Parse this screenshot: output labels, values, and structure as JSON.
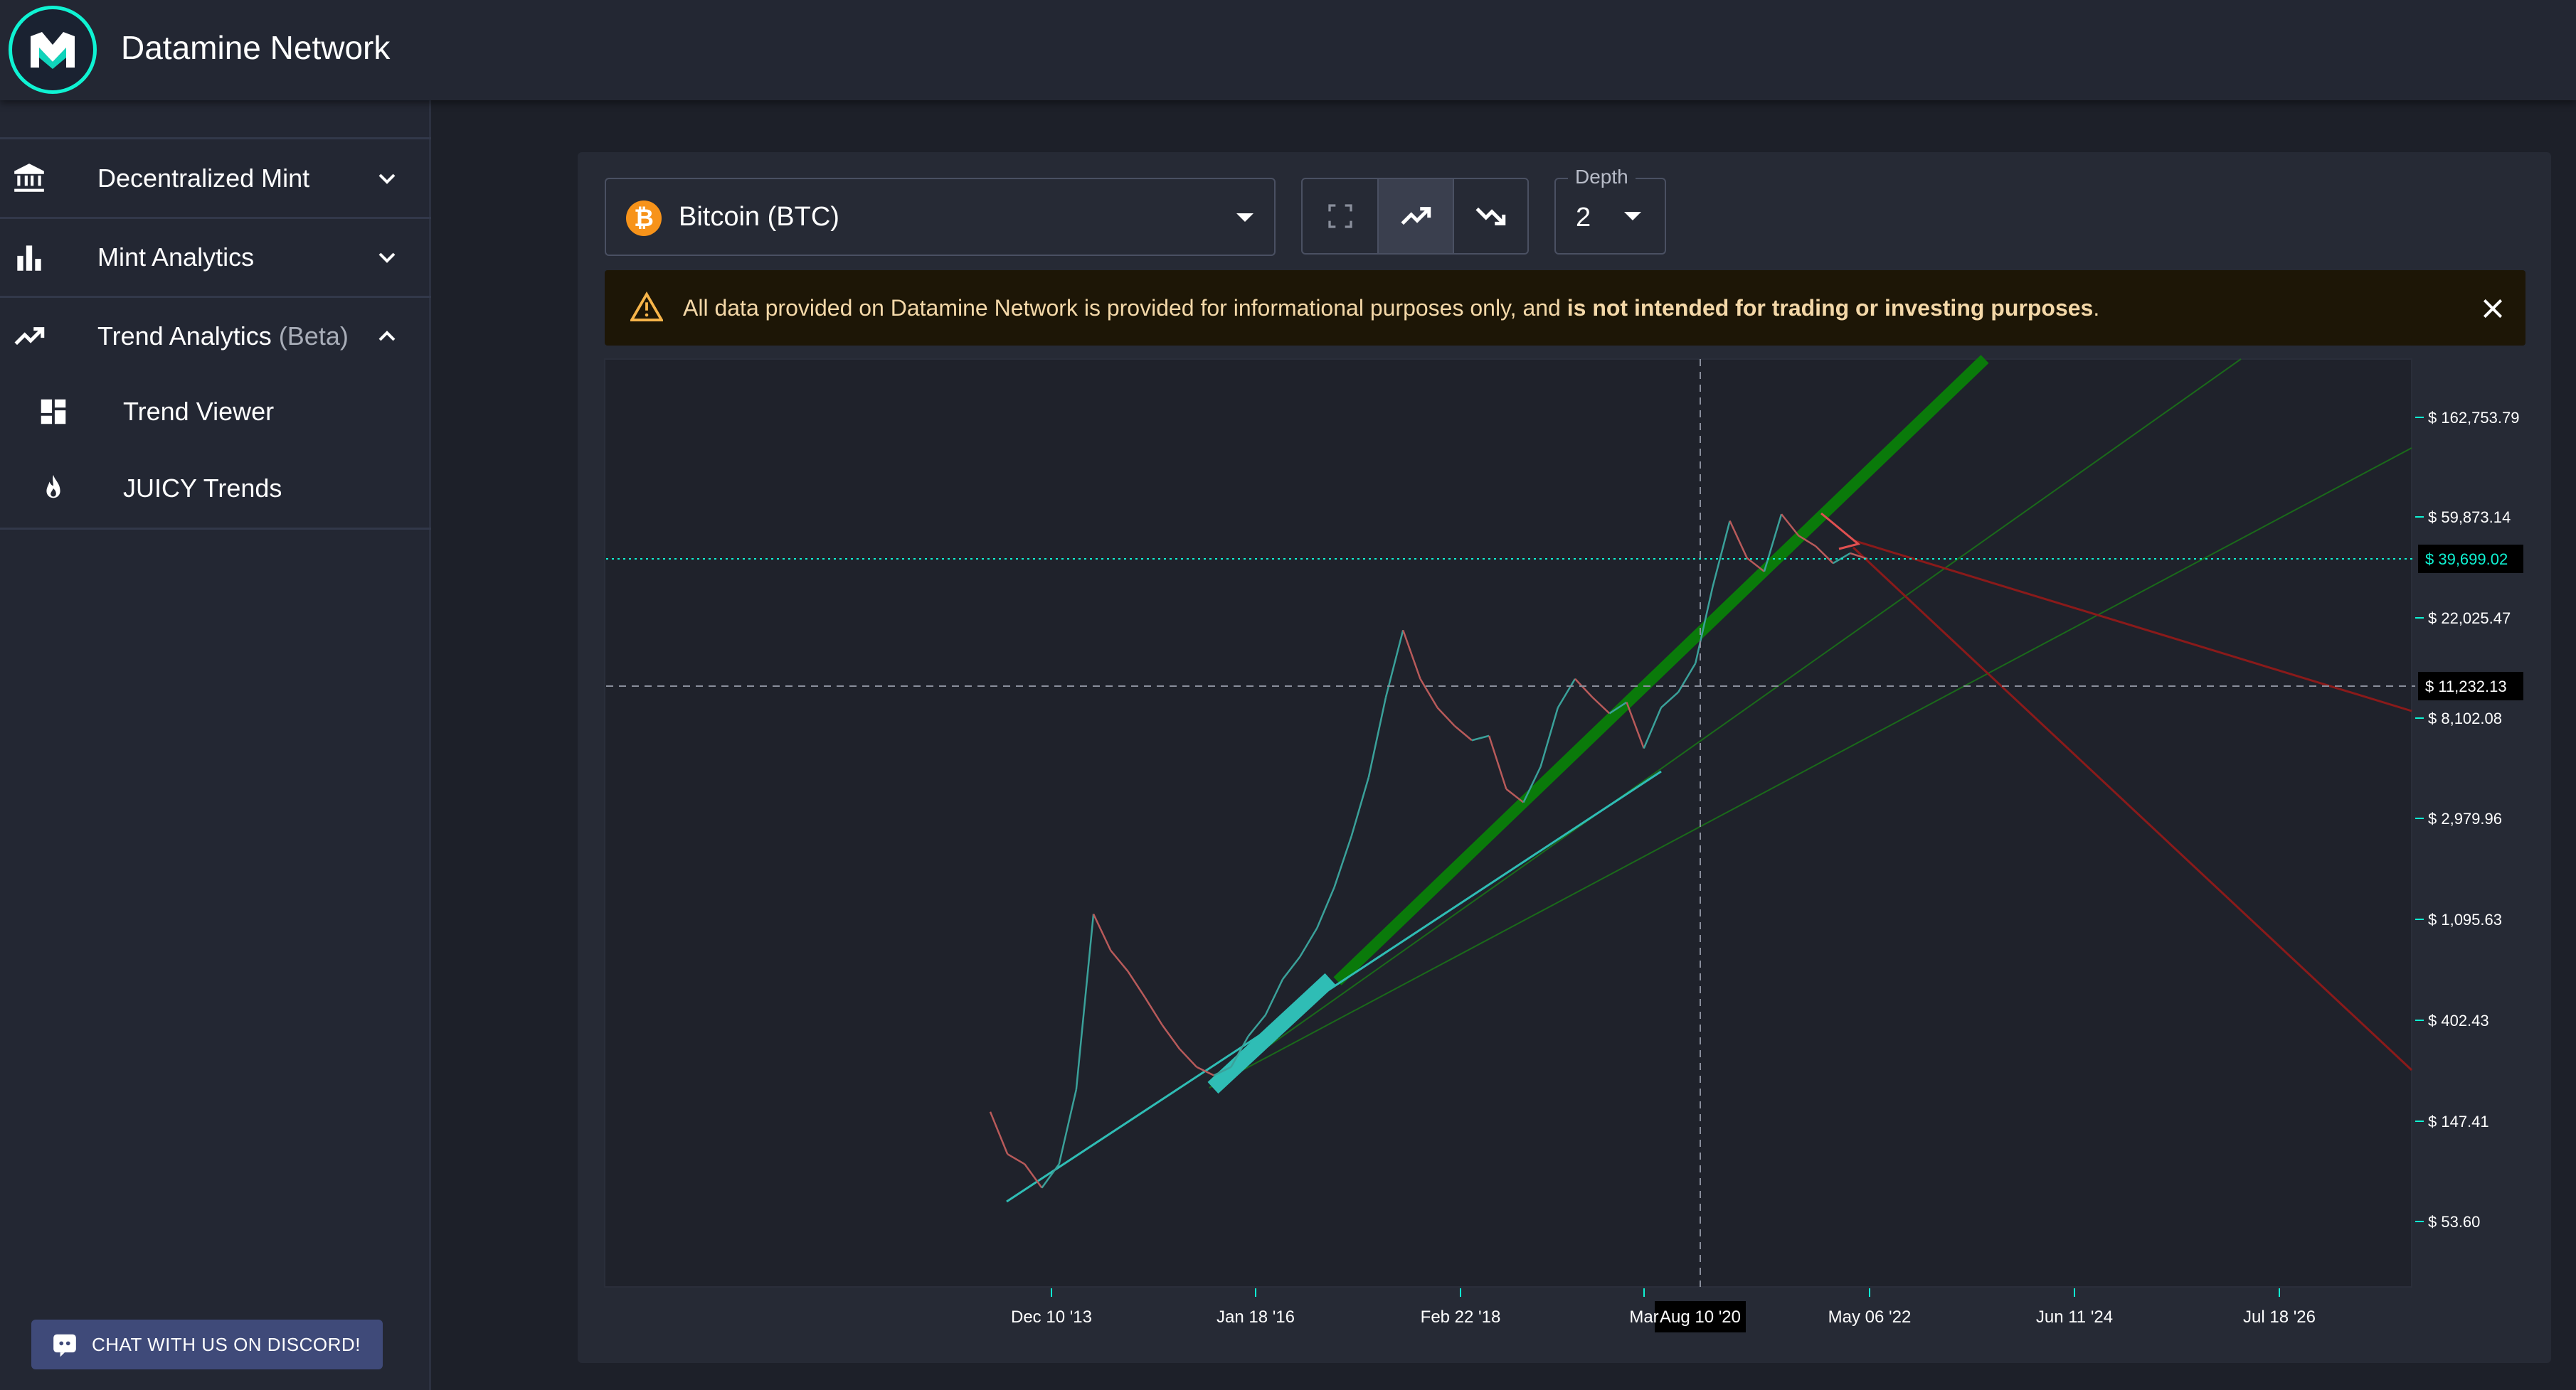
{
  "app": {
    "title": "Datamine Network"
  },
  "sidebar": {
    "items": [
      {
        "label": "Decentralized Mint",
        "icon": "bank-icon",
        "expanded": false
      },
      {
        "label": "Mint Analytics",
        "icon": "bar-chart-icon",
        "expanded": false
      },
      {
        "label": "Trend Analytics",
        "label_suffix": "(Beta)",
        "icon": "trending-up-icon",
        "expanded": true,
        "children": [
          {
            "label": "Trend Viewer",
            "icon": "dashboard-icon"
          },
          {
            "label": "JUICY Trends",
            "icon": "flame-icon"
          }
        ]
      }
    ],
    "discord_button": "CHAT WITH US ON DISCORD!"
  },
  "toolbar": {
    "coin_select": {
      "value": "Bitcoin (BTC)",
      "icon": "bitcoin-icon"
    },
    "tools": [
      {
        "icon": "fullscreen-icon",
        "active": false
      },
      {
        "icon": "trending-up-icon",
        "active": true
      },
      {
        "icon": "trending-down-icon",
        "active": false
      }
    ],
    "depth": {
      "label": "Depth",
      "value": "2"
    }
  },
  "alert": {
    "text_before": "All data provided on Datamine Network is provided for informational purposes only, and ",
    "text_bold": "is not intended for trading or investing purposes",
    "text_after": ".",
    "icon": "warning-icon"
  },
  "colors": {
    "accent": "#0ff3d3",
    "uptrend": "#0a7a0a",
    "downtrend": "#8a1a1a",
    "support": "#2fbdb5",
    "warning": "#f7b54a",
    "bitcoin": "#f7931a"
  },
  "chart_data": {
    "type": "line",
    "y_scale": "log",
    "y_ticks": [
      "$ 162,753.79",
      "$ 59,873.14",
      "$ 22,025.47",
      "$ 8,102.08",
      "$ 2,979.96",
      "$ 1,095.63",
      "$ 402.43",
      "$ 147.41",
      "$ 53.60"
    ],
    "x_ticks": [
      "Dec 10 '13",
      "Jan 18 '16",
      "Feb 22 '18",
      "Mar",
      "May 06 '22",
      "Jun 11 '24",
      "Jul 18 '26"
    ],
    "price_marker": "$ 39,699.02",
    "crosshair": {
      "x_label": "Aug 10 '20",
      "y_label": "$ 11,232.13"
    },
    "series": [
      {
        "values_usd": [
          160,
          105,
          95,
          75,
          95,
          200,
          1150,
          800,
          650,
          500,
          380,
          300,
          250,
          230,
          250,
          340,
          420,
          600,
          750,
          1000,
          1500,
          2500,
          4500,
          10000,
          19500,
          12000,
          9000,
          7500,
          6500,
          6800,
          4000,
          3500,
          5000,
          9000,
          12000,
          10000,
          8500,
          9500,
          6000,
          9000,
          10500,
          14000,
          30000,
          58000,
          40000,
          35000,
          62000,
          50000,
          45000,
          38000,
          42000,
          39699
        ]
      }
    ]
  }
}
